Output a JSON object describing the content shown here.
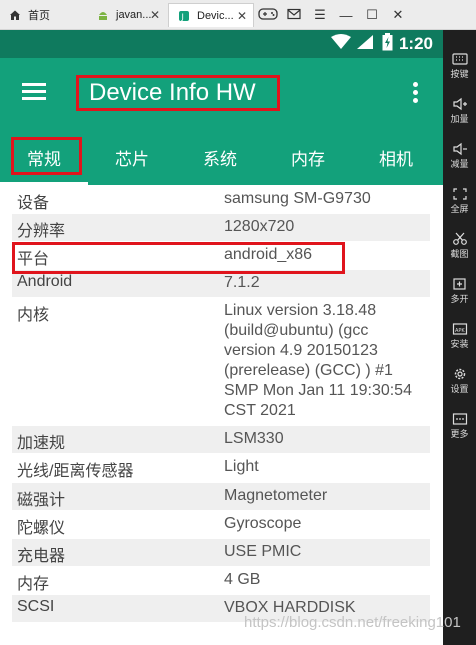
{
  "window": {
    "tabs": [
      {
        "label": "首页",
        "icon": "home-icon"
      },
      {
        "label": "javan...",
        "icon": "android-icon"
      },
      {
        "label": "Devic...",
        "icon": "app-icon"
      }
    ],
    "controls": {
      "gamepad": "gamepad-icon",
      "mail": "mail-icon",
      "menu": "menu-icon",
      "minimize": "minimize-icon",
      "maximize": "maximize-icon",
      "close": "close-icon"
    }
  },
  "emulator_sidebar": [
    {
      "label": "按键",
      "icon": "keyboard-icon"
    },
    {
      "label": "加量",
      "icon": "volume-up-icon"
    },
    {
      "label": "减量",
      "icon": "volume-down-icon"
    },
    {
      "label": "全屏",
      "icon": "fullscreen-icon"
    },
    {
      "label": "截图",
      "icon": "scissors-icon"
    },
    {
      "label": "多开",
      "icon": "multi-open-icon"
    },
    {
      "label": "安装",
      "icon": "apk-install-icon"
    },
    {
      "label": "设置",
      "icon": "gear-icon"
    },
    {
      "label": "更多",
      "icon": "more-icon"
    }
  ],
  "status_bar": {
    "time": "1:20",
    "icons": [
      "wifi-icon",
      "signal-icon",
      "battery-icon"
    ]
  },
  "app": {
    "title": "Device Info HW",
    "primary_color": "#13a17b",
    "statusbar_color": "#0f7a5e",
    "highlight_color": "#e0141c",
    "tabs": [
      "常规",
      "芯片",
      "系统",
      "内存",
      "相机"
    ],
    "active_tab": "常规"
  },
  "info_rows": [
    {
      "key": "设备",
      "value": "samsung SM-G9730"
    },
    {
      "key": "分辨率",
      "value": "1280x720"
    },
    {
      "key": "平台",
      "value": "android_x86"
    },
    {
      "key": "Android",
      "value": "7.1.2"
    },
    {
      "key": "内核",
      "lines": [
        "Linux version 3.18.48",
        "(build@ubuntu) (gcc",
        "version 4.9 20150123",
        "(prerelease) (GCC) ) #1",
        "SMP Mon Jan 11 19:30:54",
        "CST 2021"
      ]
    },
    {
      "key": "加速规",
      "value": "LSM330"
    },
    {
      "key": "光线/距离传感器",
      "value": "Light"
    },
    {
      "key": "磁强计",
      "value": "Magnetometer"
    },
    {
      "key": "陀螺仪",
      "value": "Gyroscope"
    },
    {
      "key": "充电器",
      "value": "USE PMIC"
    },
    {
      "key": "内存",
      "value": "4 GB"
    },
    {
      "key": "SCSI",
      "value": "VBOX HARDDISK"
    }
  ],
  "watermark": "https://blog.csdn.net/freeking101"
}
